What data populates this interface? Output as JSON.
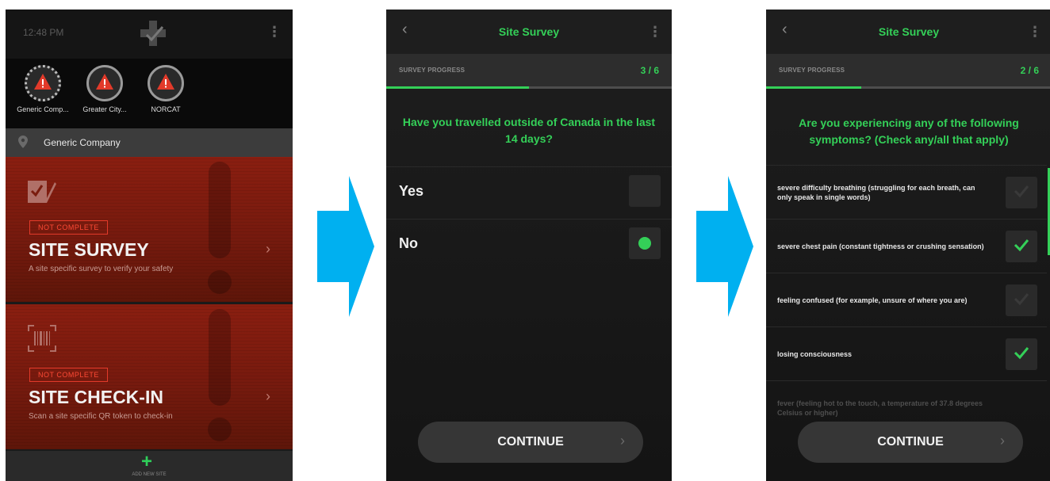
{
  "colors": {
    "accent_green": "#34d058",
    "arrow_blue": "#00b0f0",
    "alert_red": "#e23a2a",
    "card_red": "#7a1c0e"
  },
  "screen1": {
    "time": "12:48 PM",
    "menu_icon": "kebab-menu-icon",
    "sites": [
      {
        "label": "Generic Comp...",
        "icon": "warning-icon",
        "active": true
      },
      {
        "label": "Greater City...",
        "icon": "warning-icon",
        "active": false
      },
      {
        "label": "NORCAT",
        "icon": "warning-icon",
        "active": false
      }
    ],
    "location": {
      "icon": "location-pin-icon",
      "name": "Generic Company"
    },
    "cards": [
      {
        "icon": "survey-check-icon",
        "badge": "NOT COMPLETE",
        "title": "SITE SURVEY",
        "subtitle": "A site specific survey to verify your safety"
      },
      {
        "icon": "barcode-scan-icon",
        "badge": "NOT COMPLETE",
        "title": "SITE CHECK-IN",
        "subtitle": "Scan a site specific QR token to check-in"
      }
    ],
    "add_site": {
      "icon": "plus-icon",
      "label": "ADD NEW SITE"
    }
  },
  "screen2": {
    "title": "Site Survey",
    "progress_label": "SURVEY PROGRESS",
    "progress_count": "3 / 6",
    "progress_fraction": 0.5,
    "question": "Have you travelled outside of Canada in the last 14 days?",
    "options": [
      {
        "label": "Yes",
        "selected": false
      },
      {
        "label": "No",
        "selected": true
      }
    ],
    "continue_label": "CONTINUE"
  },
  "screen3": {
    "title": "Site Survey",
    "progress_label": "SURVEY PROGRESS",
    "progress_count": "2 / 6",
    "progress_fraction": 0.333,
    "question": "Are you experiencing any of the following symptoms? (Check any/all that apply)",
    "symptoms": [
      {
        "label": "severe difficulty breathing (struggling for each breath, can only speak in single words)",
        "checked": false
      },
      {
        "label": "severe chest pain (constant tightness or crushing sensation)",
        "checked": true
      },
      {
        "label": "feeling confused (for example, unsure of where you are)",
        "checked": false
      },
      {
        "label": "losing consciousness",
        "checked": true
      },
      {
        "label": "fever (feeling hot to the touch, a temperature of 37.8 degrees Celsius or higher)",
        "checked": false
      }
    ],
    "continue_label": "CONTINUE"
  }
}
